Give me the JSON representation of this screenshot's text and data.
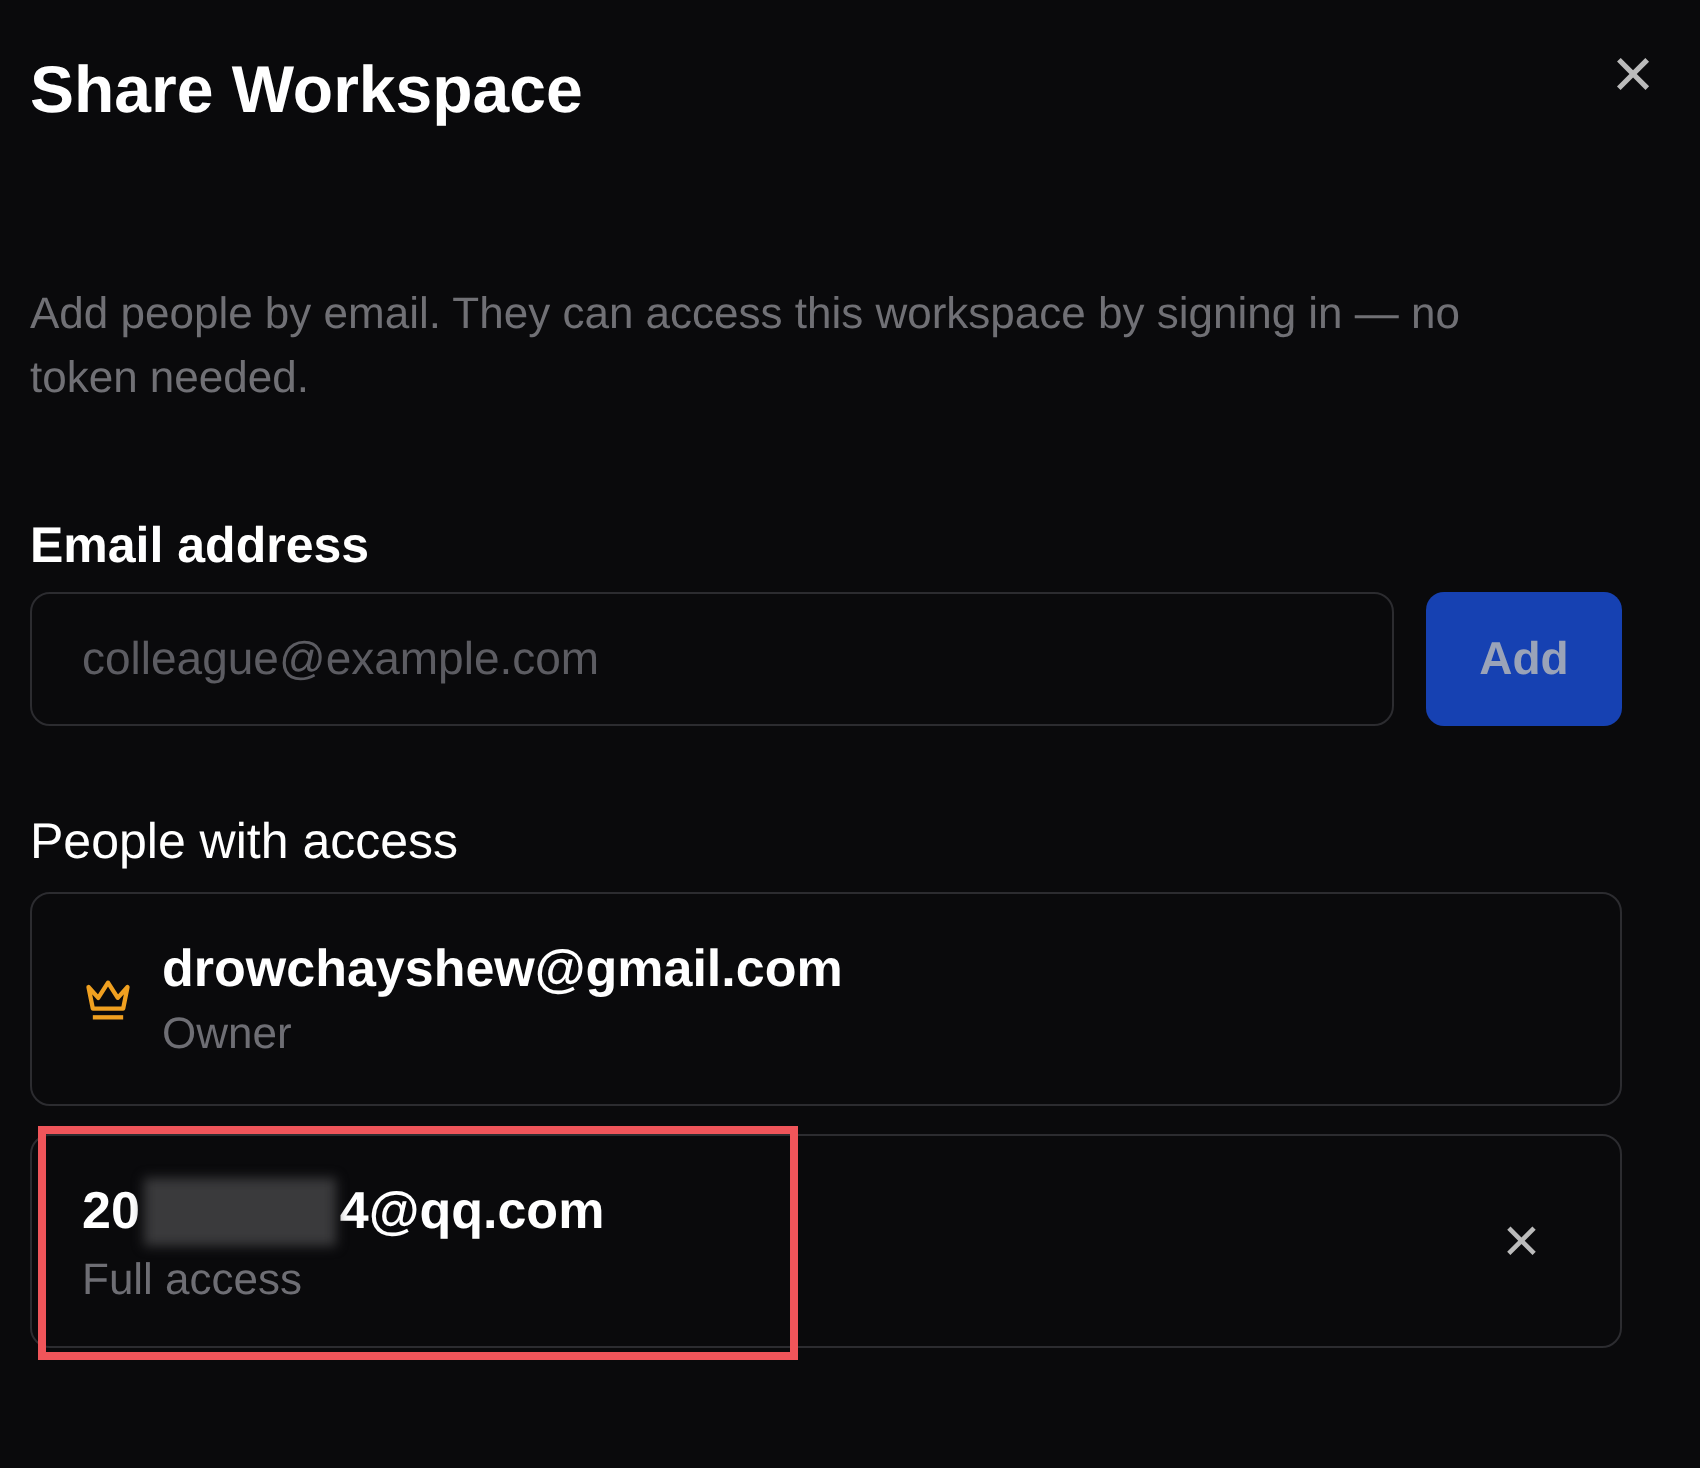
{
  "dialog": {
    "title": "Share Workspace",
    "close_label": "×",
    "description": "Add people by email. They can access this workspace by signing in — no token needed."
  },
  "invite": {
    "label": "Email address",
    "placeholder": "colleague@example.com",
    "button": {
      "label": "Add",
      "disabled": true
    }
  },
  "people": {
    "label": "People with access",
    "members": [
      {
        "kind": "owner",
        "email_start": "drowchayshew@gmail.com",
        "redacted": false,
        "role": "Owner",
        "highlighted": false
      },
      {
        "kind": "member",
        "email_start": "20",
        "email_end": "4@qq.com",
        "redacted": true,
        "role": "Full access",
        "remove_label": "×",
        "highlighted": true
      }
    ]
  }
}
